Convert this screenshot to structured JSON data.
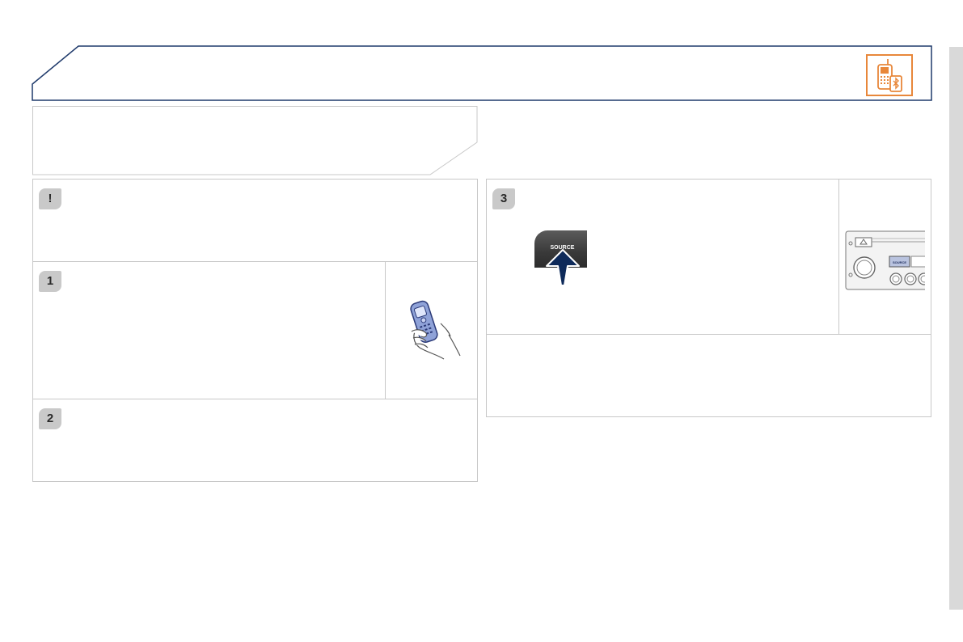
{
  "colors": {
    "header_border": "#1f3a6b",
    "icon_accent": "#e8873a",
    "badge_bg": "#c9c9c9",
    "arrow": "#0e2a5a",
    "panel_border": "#c8c8c8",
    "scrollbar": "#d9d9d9"
  },
  "header": {
    "icon": "bluetooth-phone-icon"
  },
  "steps": {
    "warning": {
      "badge": "!"
    },
    "one": {
      "badge": "1",
      "illustration": "hand-holding-phone-icon"
    },
    "two": {
      "badge": "2"
    },
    "three": {
      "badge": "3",
      "source_button_label": "SOURCE",
      "illustration": "radio-faceplate-icon",
      "radio_button_label": "SOURCE"
    }
  }
}
